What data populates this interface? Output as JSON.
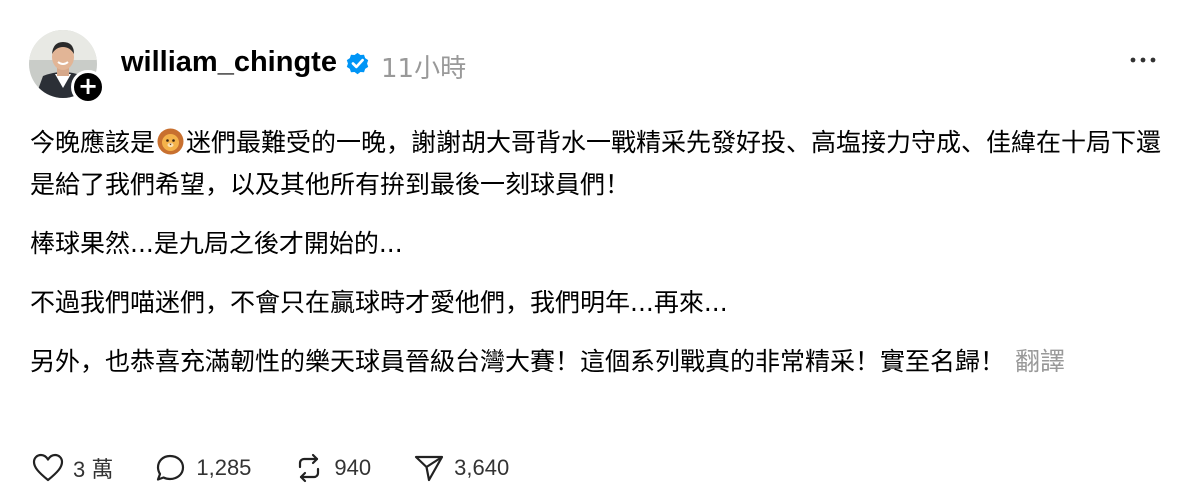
{
  "author": {
    "username": "william_chingte",
    "timestamp": "11小時",
    "verified": true
  },
  "post": {
    "paragraph1_part1": "今晚應該是",
    "paragraph1_emoji": "lion-face-emoji",
    "paragraph1_part2": "迷們最難受的一晚，謝謝胡大哥背水一戰精采先發好投、高塩接力守成、佳緯在十局下還是給了我們希望，以及其他所有拚到最後一刻球員們！",
    "paragraph2": "棒球果然...是九局之後才開始的...",
    "paragraph3": "不過我們喵迷們，不會只在贏球時才愛他們，我們明年...再來...",
    "paragraph4": "另外，也恭喜充滿韌性的樂天球員晉級台灣大賽！這個系列戰真的非常精采！實至名歸！",
    "translate_label": "翻譯"
  },
  "actions": {
    "likes": "3 萬",
    "replies": "1,285",
    "reposts": "940",
    "shares": "3,640"
  },
  "colors": {
    "verified_blue": "#0095F6",
    "muted_text": "#999999"
  },
  "icons": [
    "avatar",
    "follow-plus-icon",
    "verified-badge-icon",
    "more-options-icon",
    "heart-icon",
    "comment-icon",
    "repost-icon",
    "share-icon"
  ]
}
